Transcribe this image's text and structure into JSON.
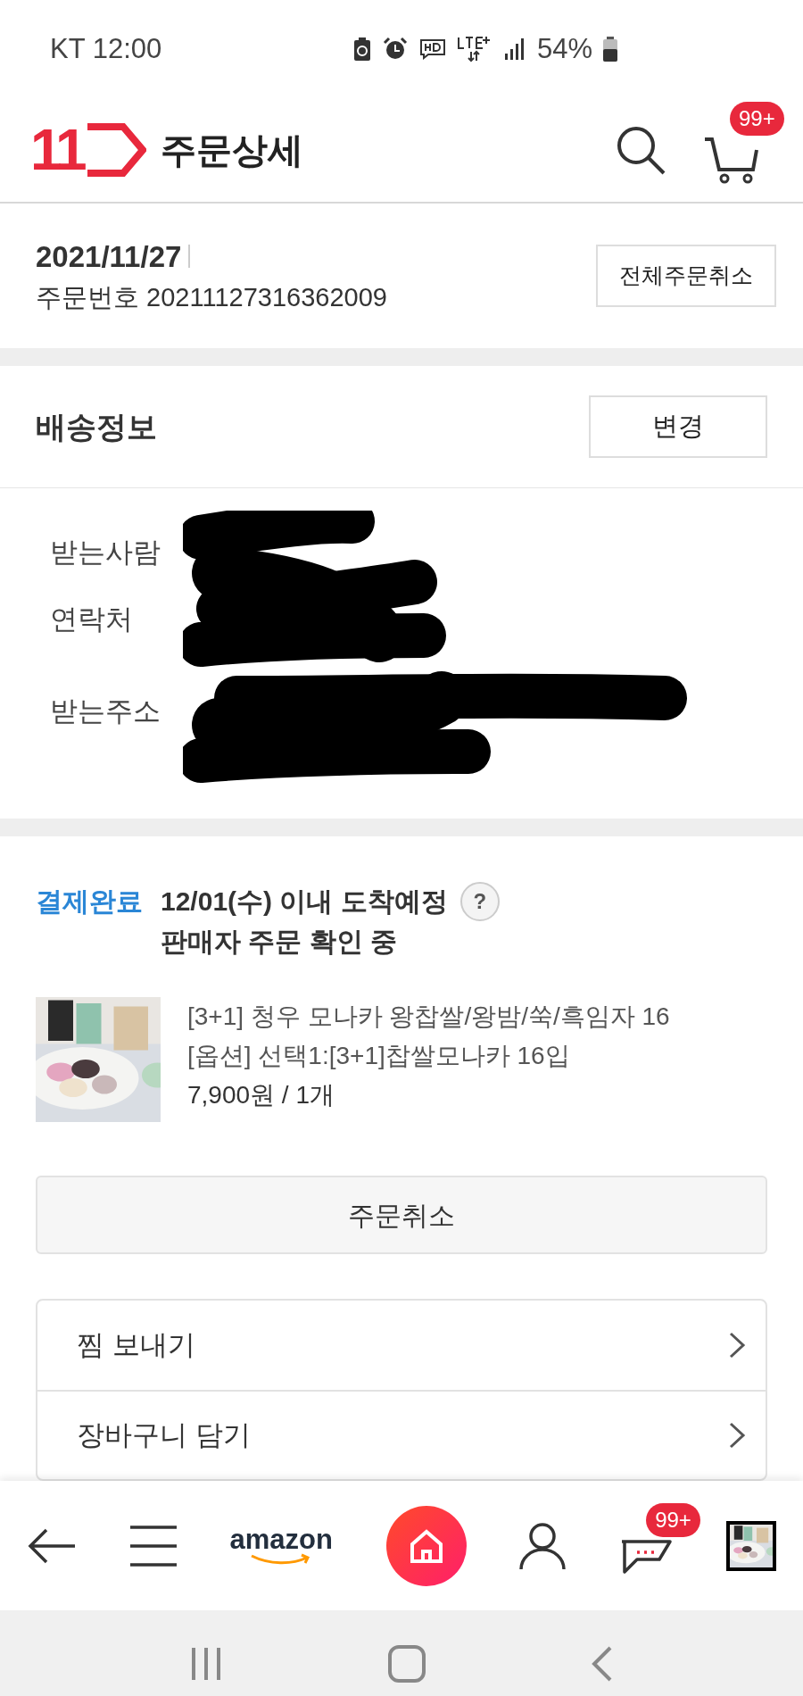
{
  "status_bar": {
    "carrier_time": "KT 12:00",
    "battery": "54%"
  },
  "header": {
    "logo": "11",
    "title": "주문상세",
    "cart_badge": "99+"
  },
  "order": {
    "date": "2021/11/27",
    "number": "주문번호 20211127316362009",
    "cancel_all": "전체주문취소"
  },
  "shipping": {
    "title": "배송정보",
    "change": "변경",
    "fields": [
      {
        "label": "받는사람"
      },
      {
        "label": "연락처"
      },
      {
        "label": "받는주소"
      }
    ]
  },
  "item": {
    "status": "결제완료",
    "arrival": "12/01(수) 이내 도착예정",
    "help": "?",
    "seller_state": "판매자 주문 확인 중",
    "product": {
      "kind": "picture",
      "name": "[3+1] 청우 모나카 왕찹쌀/왕밤/쑥/흑임자 16",
      "option": "[옵션] 선택1:[3+1]찹쌀모나카 16입",
      "price": "7,900원 / 1개"
    },
    "cancel": "주문취소"
  },
  "actions": [
    "찜 보내기",
    "장바구니 담기"
  ],
  "bottom_nav": {
    "brand": "amazon",
    "chat_badge": "99+"
  }
}
